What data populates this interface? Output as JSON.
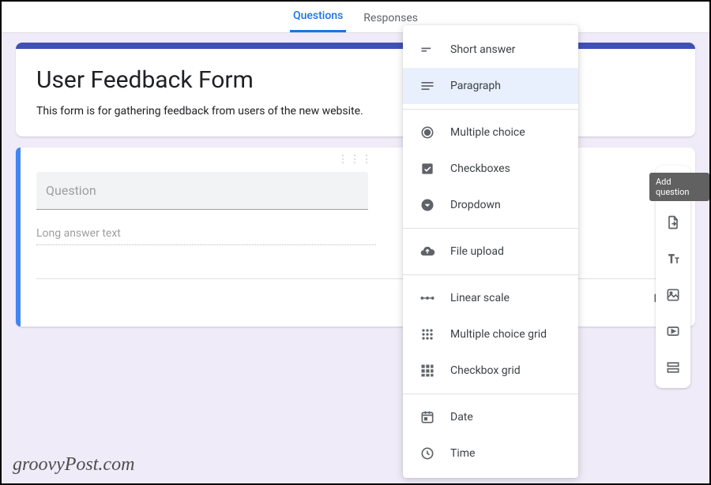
{
  "tabs": {
    "questions": "Questions",
    "responses": "Responses"
  },
  "form": {
    "title": "User Feedback Form",
    "description": "This form is for gathering feedback from users of the new website."
  },
  "question": {
    "placeholder": "Question",
    "answer_hint": "Long answer text"
  },
  "type_menu": {
    "items": [
      "Short answer",
      "Paragraph",
      "Multiple choice",
      "Checkboxes",
      "Dropdown",
      "File upload",
      "Linear scale",
      "Multiple choice grid",
      "Checkbox grid",
      "Date",
      "Time"
    ],
    "selected_index": 1
  },
  "toolbar": {
    "add_tooltip": "Add question"
  },
  "watermark": "groovyPost.com"
}
